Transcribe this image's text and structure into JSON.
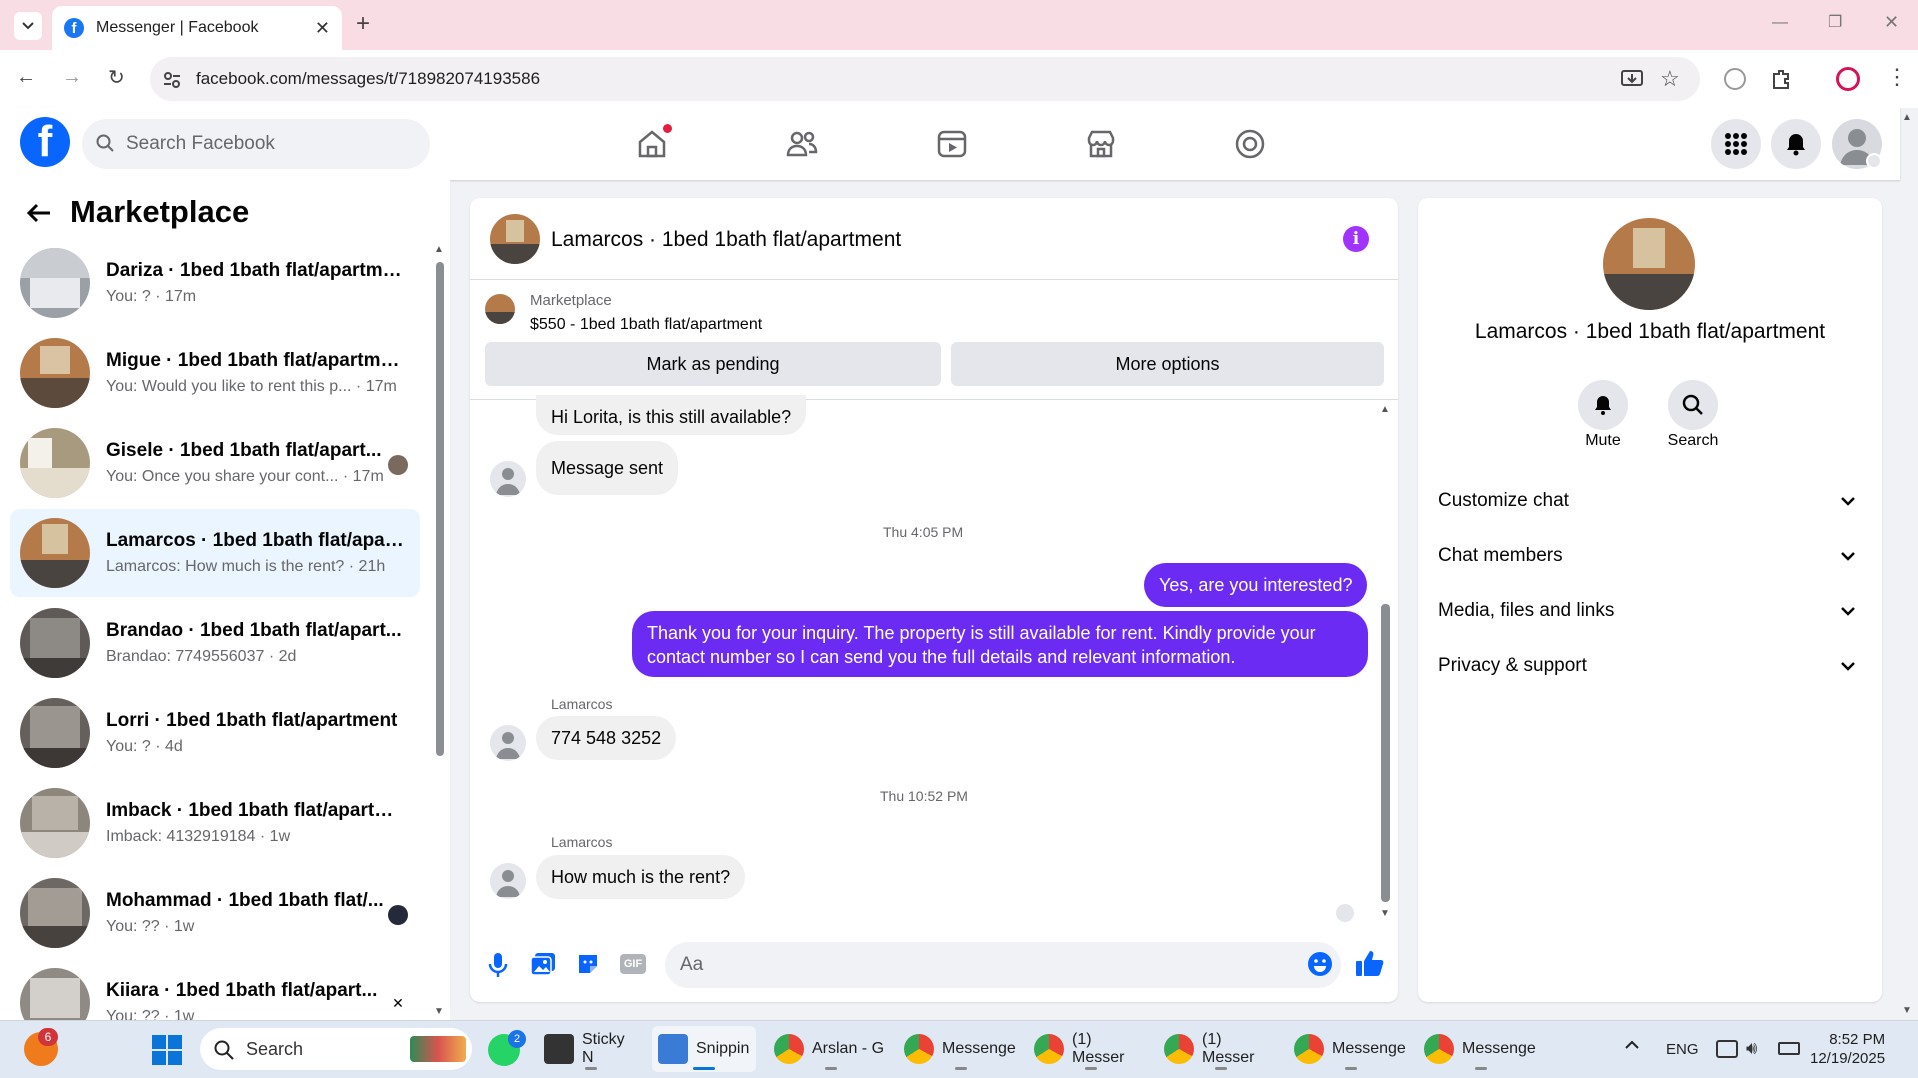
{
  "browser": {
    "tab_title": "Messenger | Facebook",
    "url": "facebook.com/messages/t/718982074193586"
  },
  "header": {
    "search_placeholder": "Search Facebook"
  },
  "sidebar": {
    "title": "Marketplace",
    "conversations": [
      {
        "name": "Dariza · 1bed 1bath flat/apartment",
        "preview": "You: ? · 17m"
      },
      {
        "name": "Migue · 1bed 1bath flat/apartment",
        "preview": "You: Would you like to rent this p... · 17m"
      },
      {
        "name": "Gisele · 1bed 1bath flat/apart...",
        "preview": "You: Once you share your cont... · 17m"
      },
      {
        "name": "Lamarcos · 1bed 1bath flat/apart...",
        "preview": "Lamarcos: How much is the rent? · 21h"
      },
      {
        "name": "Brandao · 1bed 1bath flat/apart...",
        "preview": "Brandao: 7749556037 · 2d"
      },
      {
        "name": "Lorri · 1bed 1bath flat/apartment",
        "preview": "You: ? · 4d"
      },
      {
        "name": "Imback · 1bed 1bath flat/apartm...",
        "preview": "Imback: 4132919184 · 1w"
      },
      {
        "name": "Mohammad · 1bed 1bath flat/...",
        "preview": "You: ?? · 1w"
      },
      {
        "name": "Kiiara · 1bed 1bath flat/apart...",
        "preview": "You: ?? · 1w"
      }
    ]
  },
  "chat": {
    "title": "Lamarcos · 1bed 1bath flat/apartment",
    "listing_label": "Marketplace",
    "listing_item": "$550 - 1bed 1bath flat/apartment",
    "mark_pending": "Mark as pending",
    "more_options": "More options",
    "msg1": "Hi Lorita, is this still available?",
    "msg2": "Message sent",
    "time1": "Thu 4:05 PM",
    "msg3": "Yes, are you interested?",
    "msg4_line1": "Thank you for your inquiry. The property is still available for rent. Kindly provide your",
    "msg4_line2": "contact number so I can send you the full details and relevant information.",
    "sender1": "Lamarcos",
    "msg5": "774 548 3252",
    "time2": "Thu 10:52 PM",
    "sender2": "Lamarcos",
    "msg6": "How much is the rent?",
    "composer_placeholder": "Aa",
    "gif_label": "GIF"
  },
  "details": {
    "title": "Lamarcos · 1bed 1bath flat/apartment",
    "mute": "Mute",
    "search": "Search",
    "sections": [
      "Customize chat",
      "Chat members",
      "Media, files and links",
      "Privacy & support"
    ]
  },
  "taskbar": {
    "search": "Search",
    "apps": [
      "Sticky N",
      "Snippin",
      "Arslan - G",
      "Messenge",
      "(1) Messer",
      "(1) Messer",
      "Messenge",
      "Messenge"
    ],
    "lang": "ENG",
    "time": "8:52 PM",
    "date": "12/19/2025",
    "whatsapp_badge": "2",
    "notif_badge": "6"
  }
}
